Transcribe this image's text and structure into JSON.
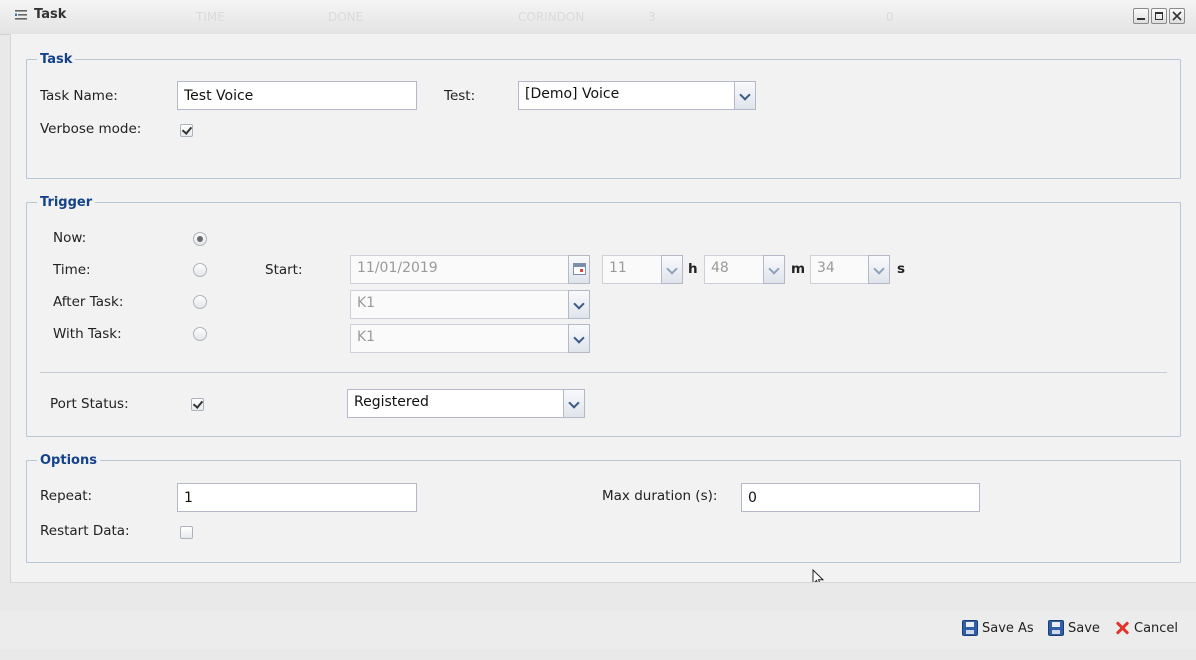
{
  "window": {
    "title": "Task",
    "ghost_headers": [
      "TIME",
      "DONE",
      "CORINDON",
      "3",
      "0"
    ]
  },
  "task": {
    "legend": "Task",
    "task_name_label": "Task Name:",
    "task_name_value": "Test Voice",
    "test_label": "Test:",
    "test_value": "[Demo] Voice",
    "verbose_label": "Verbose mode:",
    "verbose_checked": true
  },
  "trigger": {
    "legend": "Trigger",
    "now_label": "Now:",
    "time_label": "Time:",
    "after_task_label": "After Task:",
    "with_task_label": "With Task:",
    "selected": "now",
    "start_label": "Start:",
    "start_date": "11/01/2019",
    "hour": "11",
    "hour_unit": "h",
    "minute": "48",
    "minute_unit": "m",
    "second": "34",
    "second_unit": "s",
    "after_task_value": "K1",
    "with_task_value": "K1",
    "port_status_label": "Port Status:",
    "port_status_checked": true,
    "port_status_value": "Registered"
  },
  "options": {
    "legend": "Options",
    "repeat_label": "Repeat:",
    "repeat_value": "1",
    "max_duration_label": "Max duration (s):",
    "max_duration_value": "0",
    "restart_data_label": "Restart Data:",
    "restart_data_checked": false
  },
  "footer": {
    "save_as_label": "Save As",
    "save_label": "Save",
    "cancel_label": "Cancel"
  },
  "colors": {
    "legend": "#15428b",
    "cancel_icon": "#e0352b",
    "save_icon": "#2f5fa8"
  }
}
